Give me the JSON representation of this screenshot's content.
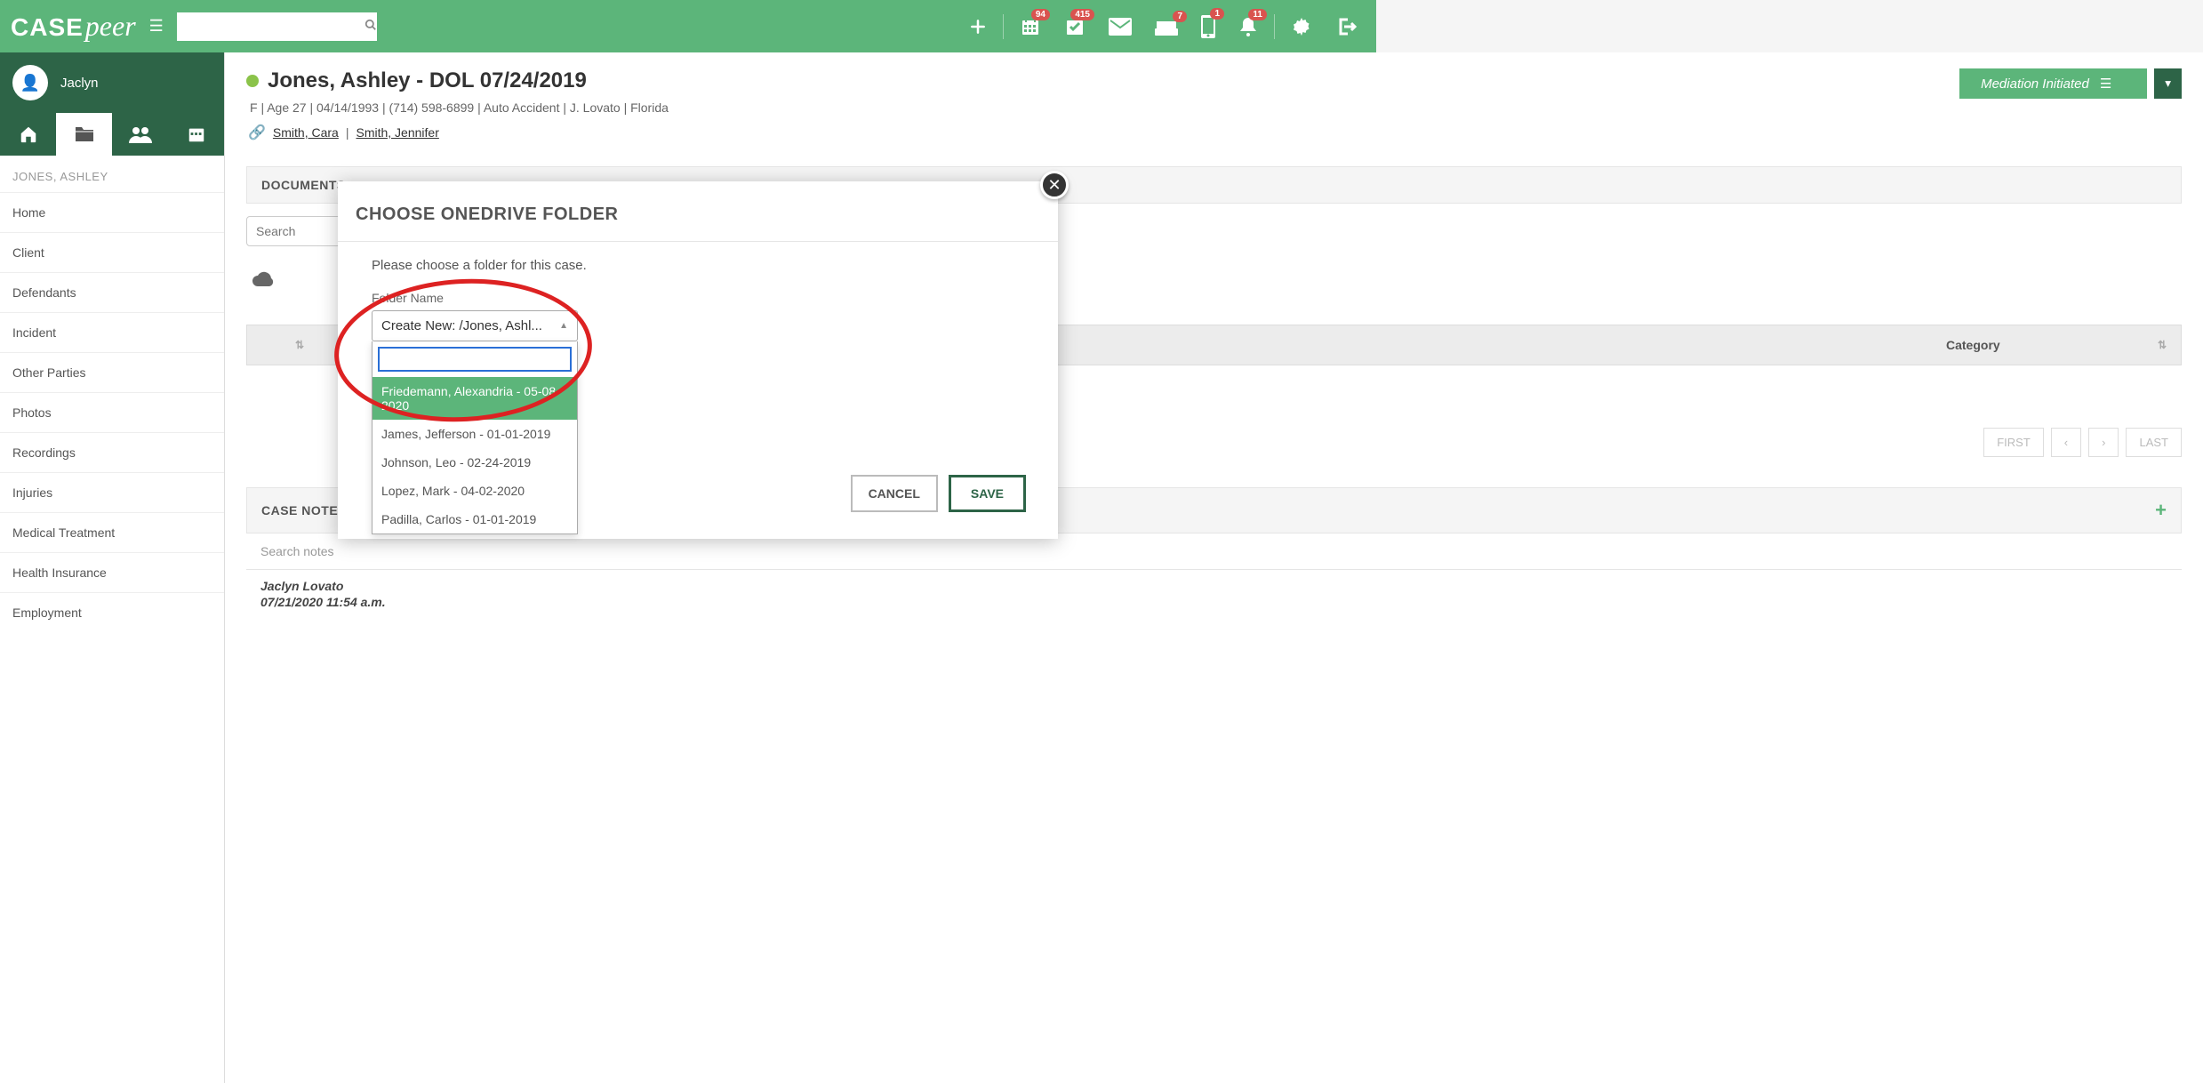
{
  "header": {
    "logo_case": "CASE",
    "logo_peer": "peer",
    "badges": {
      "cal": "94",
      "env": "415",
      "inbox": "7",
      "mobile": "1",
      "bell": "11"
    }
  },
  "user": {
    "name": "Jaclyn"
  },
  "sidebar": {
    "case_label": "JONES, ASHLEY",
    "items": [
      "Home",
      "Client",
      "Defendants",
      "Incident",
      "Other Parties",
      "Photos",
      "Recordings",
      "Injuries",
      "Medical Treatment",
      "Health Insurance",
      "Employment"
    ]
  },
  "case": {
    "title": "Jones, Ashley - DOL 07/24/2019",
    "meta": "F  |  Age 27  |  04/14/1993  |  (714) 598-6899  |  Auto Accident  |  J. Lovato  |  Florida",
    "link1": "Smith, Cara",
    "link_sep": "|",
    "link2": "Smith, Jennifer",
    "status": "Mediation Initiated"
  },
  "docs": {
    "section": "DOCUMENTS",
    "search_placeholder": "Search",
    "col_category": "Category",
    "first": "FIRST",
    "last": "LAST"
  },
  "notes": {
    "section": "CASE NOTE",
    "search_placeholder": "Search notes",
    "author": "Jaclyn Lovato",
    "time": "07/21/2020 11:54 a.m."
  },
  "modal": {
    "title": "CHOOSE ONEDRIVE FOLDER",
    "text": "Please choose a folder for this case.",
    "field_label": "Folder Name",
    "selected": "Create New: /Jones, Ashl...",
    "options": [
      "Friedemann, Alexandria - 05-08-2020",
      "James, Jefferson - 01-01-2019",
      "Johnson, Leo - 02-24-2019",
      "Lopez, Mark - 04-02-2020",
      "Padilla, Carlos - 01-01-2019"
    ],
    "cancel": "CANCEL",
    "save": "SAVE"
  }
}
